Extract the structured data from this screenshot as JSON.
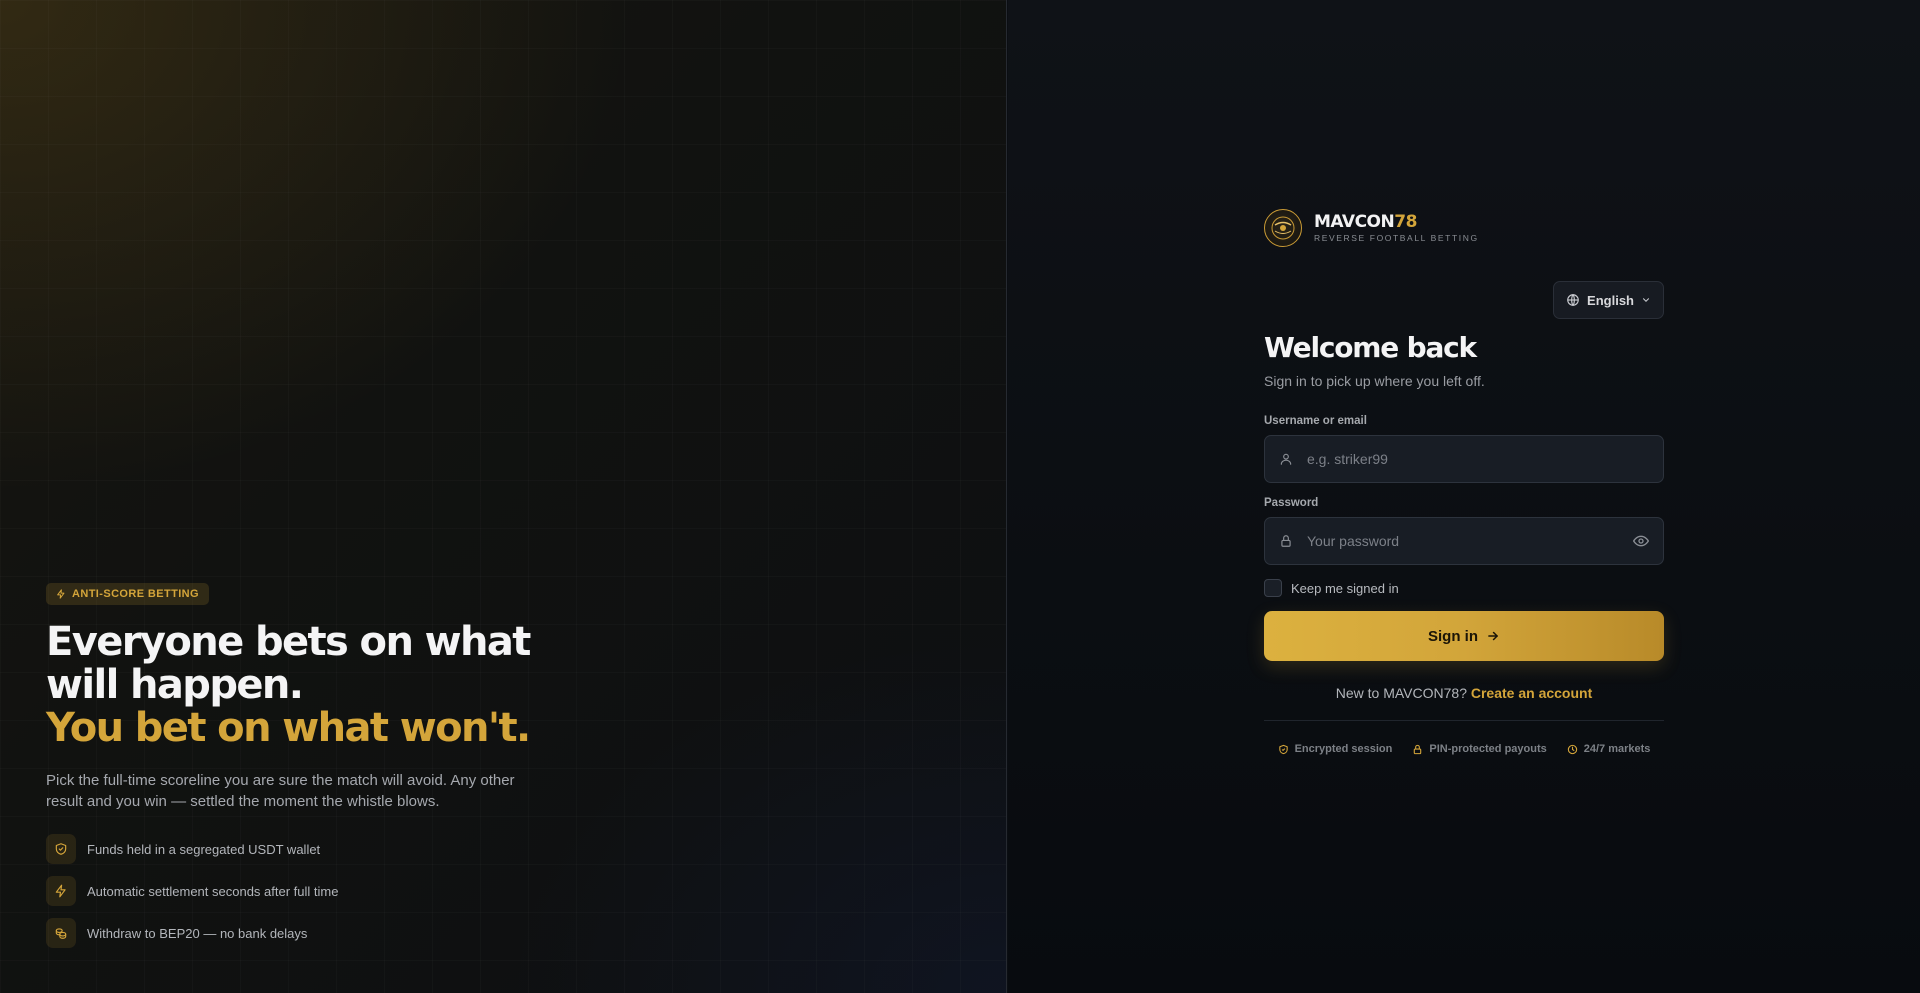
{
  "hero": {
    "badge": "ANTI-SCORE BETTING",
    "headline_line1": "Everyone bets on what",
    "headline_line2": "will happen.",
    "headline_gold": "You bet on what won't.",
    "subtitle": "Pick the full-time scoreline you are sure the match will avoid. Any other result and you win — settled the moment the whistle blows.",
    "features": [
      {
        "icon": "shield-check-icon",
        "text": "Funds held in a segregated USDT wallet"
      },
      {
        "icon": "lightning-icon",
        "text": "Automatic settlement seconds after full time"
      },
      {
        "icon": "coins-icon",
        "text": "Withdraw to BEP20 — no bank delays"
      }
    ]
  },
  "brand": {
    "name_main": "MAVCON",
    "name_num": "78",
    "tagline": "REVERSE FOOTBALL BETTING"
  },
  "language": {
    "selected": "English"
  },
  "login": {
    "title": "Welcome back",
    "subtitle": "Sign in to pick up where you left off.",
    "username_label": "Username or email",
    "username_placeholder": "e.g. striker99",
    "password_label": "Password",
    "password_placeholder": "Your password",
    "remember_label": "Keep me signed in",
    "submit_label": "Sign in",
    "register_prompt": "New to MAVCON78?",
    "register_link": "Create an account"
  },
  "trust": [
    {
      "icon": "shield-icon",
      "text": "Encrypted session"
    },
    {
      "icon": "lock-icon",
      "text": "PIN-protected payouts"
    },
    {
      "icon": "clock-icon",
      "text": "24/7 markets"
    }
  ],
  "colors": {
    "accent": "#d4a53a",
    "background": "#0b0e13"
  }
}
